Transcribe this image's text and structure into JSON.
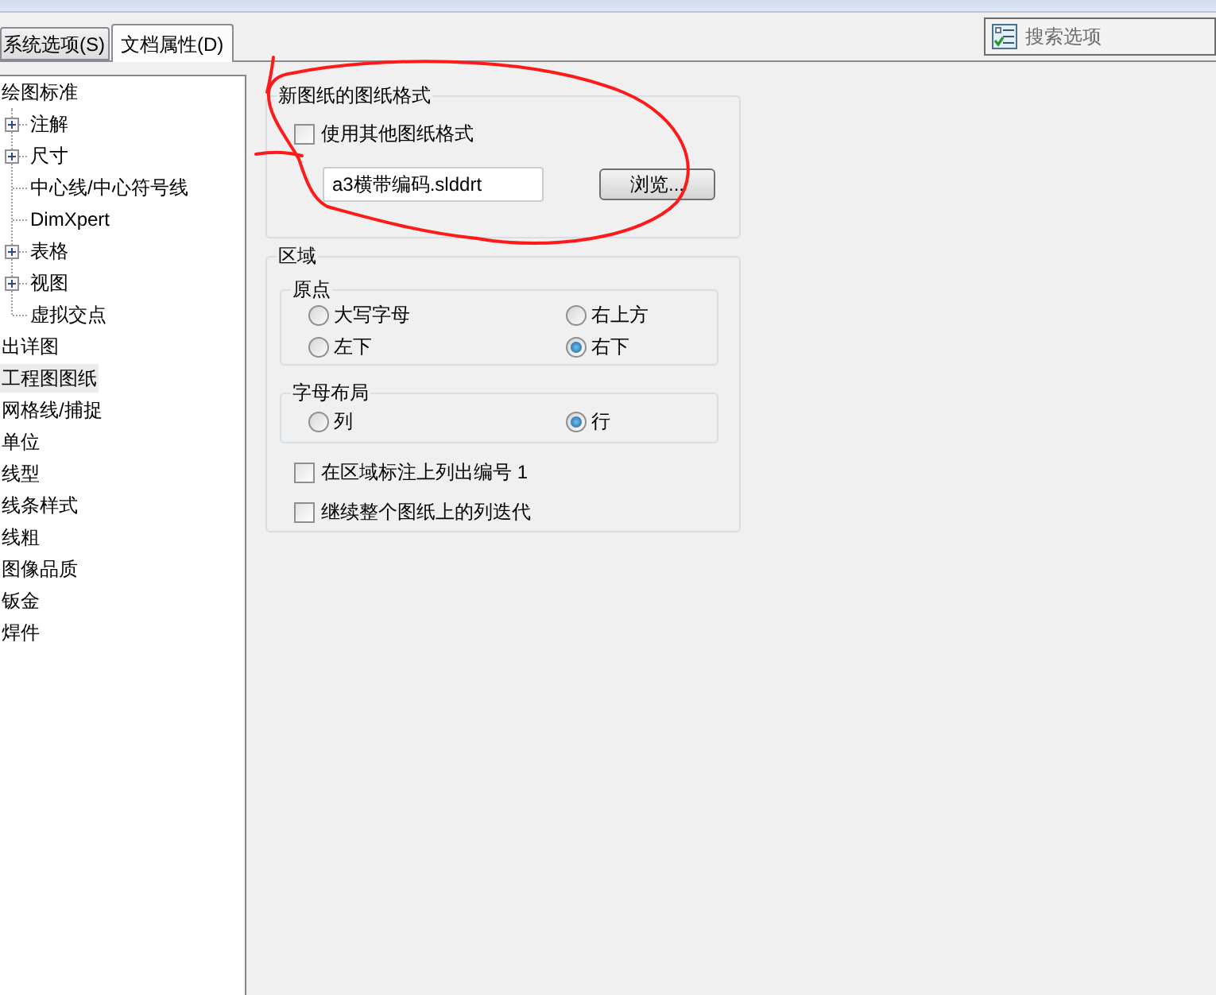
{
  "tabs": [
    {
      "label": "系统选项(S)",
      "selected": false
    },
    {
      "label": "文档属性(D)",
      "selected": true
    }
  ],
  "search": {
    "placeholder": "搜索选项"
  },
  "tree": [
    {
      "label": "绘图标准",
      "selected": false,
      "children": [
        {
          "label": "注解",
          "kind": "branch",
          "expanded": false,
          "selected": false
        },
        {
          "label": "尺寸",
          "kind": "branch",
          "expanded": false,
          "selected": false
        },
        {
          "label": "中心线/中心符号线",
          "kind": "leaf",
          "selected": false
        },
        {
          "label": "DimXpert",
          "kind": "leaf",
          "selected": false
        },
        {
          "label": "表格",
          "kind": "branch",
          "expanded": false,
          "selected": false
        },
        {
          "label": "视图",
          "kind": "branch",
          "expanded": false,
          "selected": false
        },
        {
          "label": "虚拟交点",
          "kind": "leaf",
          "selected": false
        }
      ]
    },
    {
      "label": "出详图",
      "selected": false
    },
    {
      "label": "工程图图纸",
      "selected": true
    },
    {
      "label": "网格线/捕捉",
      "selected": false
    },
    {
      "label": "单位",
      "selected": false
    },
    {
      "label": "线型",
      "selected": false
    },
    {
      "label": "线条样式",
      "selected": false
    },
    {
      "label": "线粗",
      "selected": false
    },
    {
      "label": "图像品质",
      "selected": false
    },
    {
      "label": "钣金",
      "selected": false
    },
    {
      "label": "焊件",
      "selected": false
    }
  ],
  "sheet_format": {
    "title": "新图纸的图纸格式",
    "use_other_format": {
      "label": "使用其他图纸格式",
      "checked": false
    },
    "file_field": {
      "value": "a3横带编码.slddrt"
    },
    "browse_button": {
      "label": "浏览..."
    }
  },
  "zones": {
    "title": "区域",
    "origin": {
      "title": "原点",
      "options": [
        {
          "label": "大写字母",
          "selected": false
        },
        {
          "label": "右上方",
          "selected": false
        },
        {
          "label": "左下",
          "selected": false
        },
        {
          "label": "右下",
          "selected": true
        }
      ]
    },
    "letter_layout": {
      "title": "字母布局",
      "options": [
        {
          "label": "列",
          "selected": false
        },
        {
          "label": "行",
          "selected": true
        }
      ]
    },
    "options": [
      {
        "label": "在区域标注上列出编号 1",
        "checked": false
      },
      {
        "label": "继续整个图纸上的列迭代",
        "checked": false
      }
    ]
  }
}
